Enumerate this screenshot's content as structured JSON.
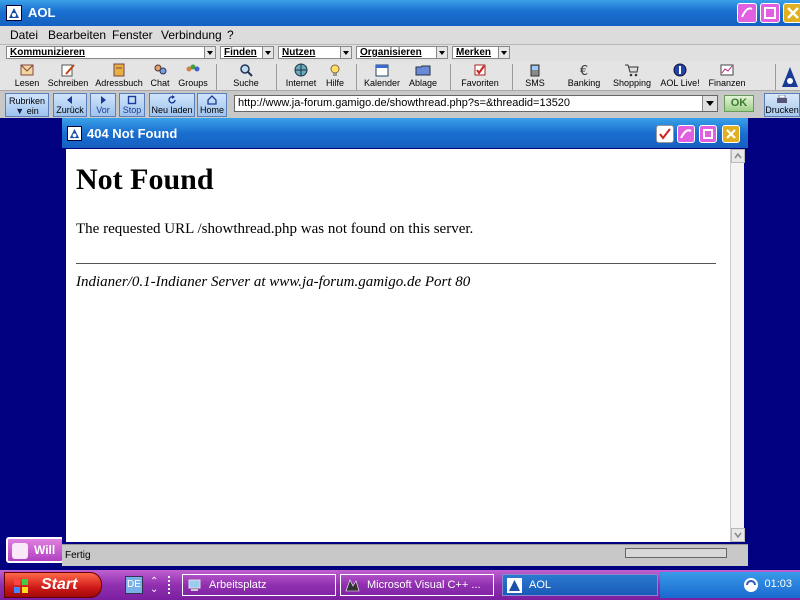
{
  "app": {
    "title": "AOL"
  },
  "colors": {
    "titlebar": "#1a6fd0",
    "taskbar": "#9030b0",
    "desktop": "#000080",
    "ok_text": "#3a7a2a"
  },
  "menu": {
    "items": [
      "Datei",
      "Bearbeiten",
      "Fenster",
      "Verbindung",
      "?"
    ]
  },
  "channels": {
    "items": [
      "Kommunizieren",
      "Finden",
      "Nutzen",
      "Organisieren",
      "Merken"
    ]
  },
  "toolbar": {
    "items": [
      {
        "label": "Lesen",
        "icon": "mail-icon"
      },
      {
        "label": "Schreiben",
        "icon": "write-icon"
      },
      {
        "label": "Adressbuch",
        "icon": "addressbook-icon"
      },
      {
        "label": "Chat",
        "icon": "chat-icon"
      },
      {
        "label": "Groups",
        "icon": "groups-icon"
      },
      {
        "label": "Suche",
        "icon": "search-icon"
      },
      {
        "label": "Internet",
        "icon": "globe-icon"
      },
      {
        "label": "Hilfe",
        "icon": "help-icon"
      },
      {
        "label": "Kalender",
        "icon": "calendar-icon"
      },
      {
        "label": "Ablage",
        "icon": "folder-icon"
      },
      {
        "label": "Favoriten",
        "icon": "favorites-icon"
      },
      {
        "label": "SMS",
        "icon": "sms-icon"
      },
      {
        "label": "Banking",
        "icon": "euro-icon"
      },
      {
        "label": "Shopping",
        "icon": "cart-icon"
      },
      {
        "label": "AOL Live!",
        "icon": "live-icon"
      },
      {
        "label": "Finanzen",
        "icon": "chart-icon"
      }
    ]
  },
  "nav": {
    "rubriken_line1": "Rubriken",
    "rubriken_line2": "ein",
    "back": "Zurück",
    "forward": "Vor",
    "stop": "Stop",
    "reload": "Neu laden",
    "home": "Home",
    "url": "http://www.ja-forum.gamigo.de/showthread.php?s=&threadid=13520",
    "ok": "OK",
    "print": "Drucken"
  },
  "window": {
    "title": "404 Not Found"
  },
  "page": {
    "heading": "Not Found",
    "message": "The requested URL /showthread.php was not found on this server.",
    "address": "Indianer/0.1-Indianer Server at www.ja-forum.gamigo.de Port 80"
  },
  "status": {
    "text": "Fertig"
  },
  "side_tab": {
    "label": "Will"
  },
  "taskbar": {
    "start": "Start",
    "lang": "DE",
    "tasks": [
      "Arbeitsplatz",
      "Microsoft Visual C++ ...",
      "AOL"
    ],
    "clock": "01:03"
  }
}
